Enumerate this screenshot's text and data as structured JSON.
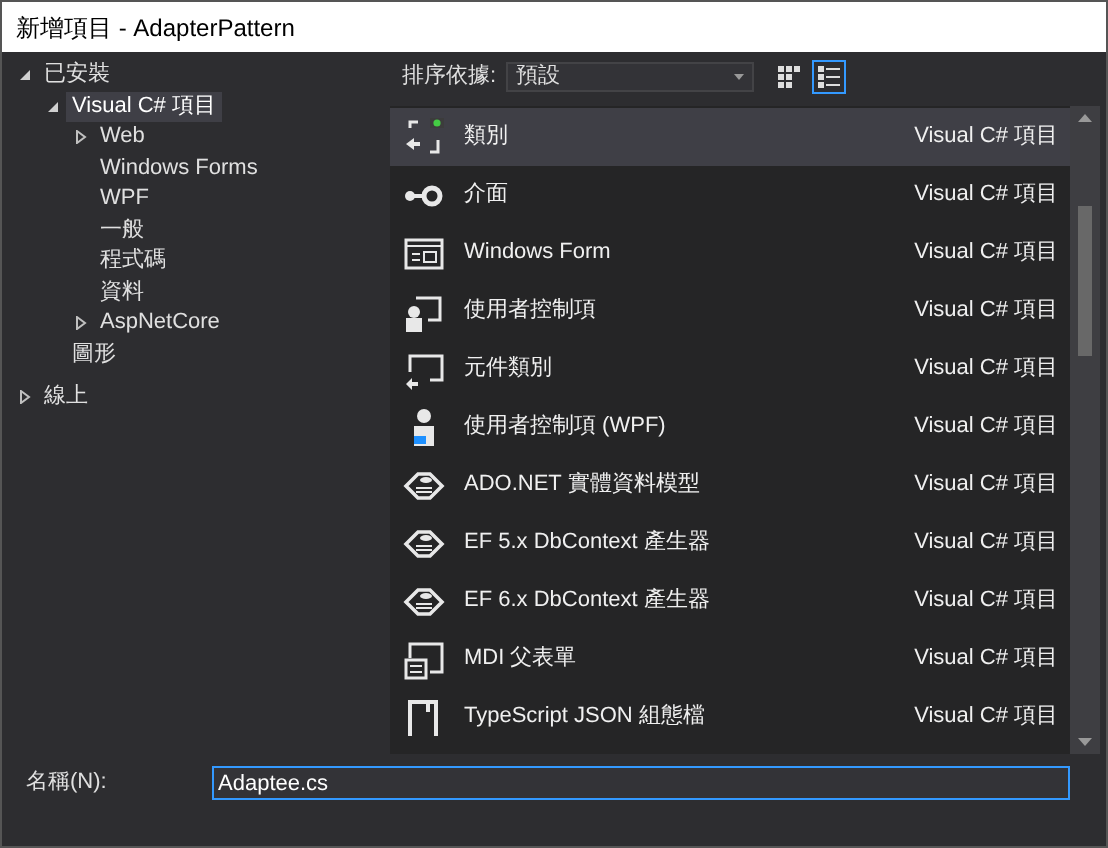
{
  "window": {
    "title": "新增項目 - AdapterPattern"
  },
  "tree": [
    {
      "label": "已安裝",
      "expanded": true,
      "selected": false,
      "children": [
        {
          "label": "Visual C# 項目",
          "expanded": true,
          "selected": true,
          "children": [
            {
              "label": "Web",
              "expanded": false,
              "selected": false
            },
            {
              "label": "Windows Forms",
              "selected": false
            },
            {
              "label": "WPF",
              "selected": false
            },
            {
              "label": "一般",
              "selected": false
            },
            {
              "label": "程式碼",
              "selected": false
            },
            {
              "label": "資料",
              "selected": false
            },
            {
              "label": "AspNetCore",
              "expanded": false,
              "selected": false
            }
          ]
        },
        {
          "label": "圖形",
          "selected": false
        }
      ]
    },
    {
      "label": "線上",
      "expanded": false,
      "selected": false
    }
  ],
  "sort": {
    "label": "排序依據:",
    "value": "預設"
  },
  "view_buttons": [
    {
      "selected": false
    },
    {
      "selected": true
    }
  ],
  "items": [
    {
      "name": "類別",
      "type": "Visual C# 項目",
      "selected": true
    },
    {
      "name": "介面",
      "type": "Visual C# 項目",
      "selected": false
    },
    {
      "name": "Windows Form",
      "type": "Visual C# 項目",
      "selected": false
    },
    {
      "name": "使用者控制項",
      "type": "Visual C# 項目",
      "selected": false
    },
    {
      "name": "元件類別",
      "type": "Visual C# 項目",
      "selected": false
    },
    {
      "name": "使用者控制項 (WPF)",
      "type": "Visual C# 項目",
      "selected": false
    },
    {
      "name": "ADO.NET 實體資料模型",
      "type": "Visual C# 項目",
      "selected": false
    },
    {
      "name": "EF 5.x DbContext 產生器",
      "type": "Visual C# 項目",
      "selected": false
    },
    {
      "name": "EF 6.x DbContext 產生器",
      "type": "Visual C# 項目",
      "selected": false
    },
    {
      "name": "MDI 父表單",
      "type": "Visual C# 項目",
      "selected": false
    },
    {
      "name": "TypeScript JSON 組態檔",
      "type": "Visual C# 項目",
      "selected": false
    }
  ],
  "name_field": {
    "label": "名稱(N):",
    "value": "Adaptee.cs"
  }
}
